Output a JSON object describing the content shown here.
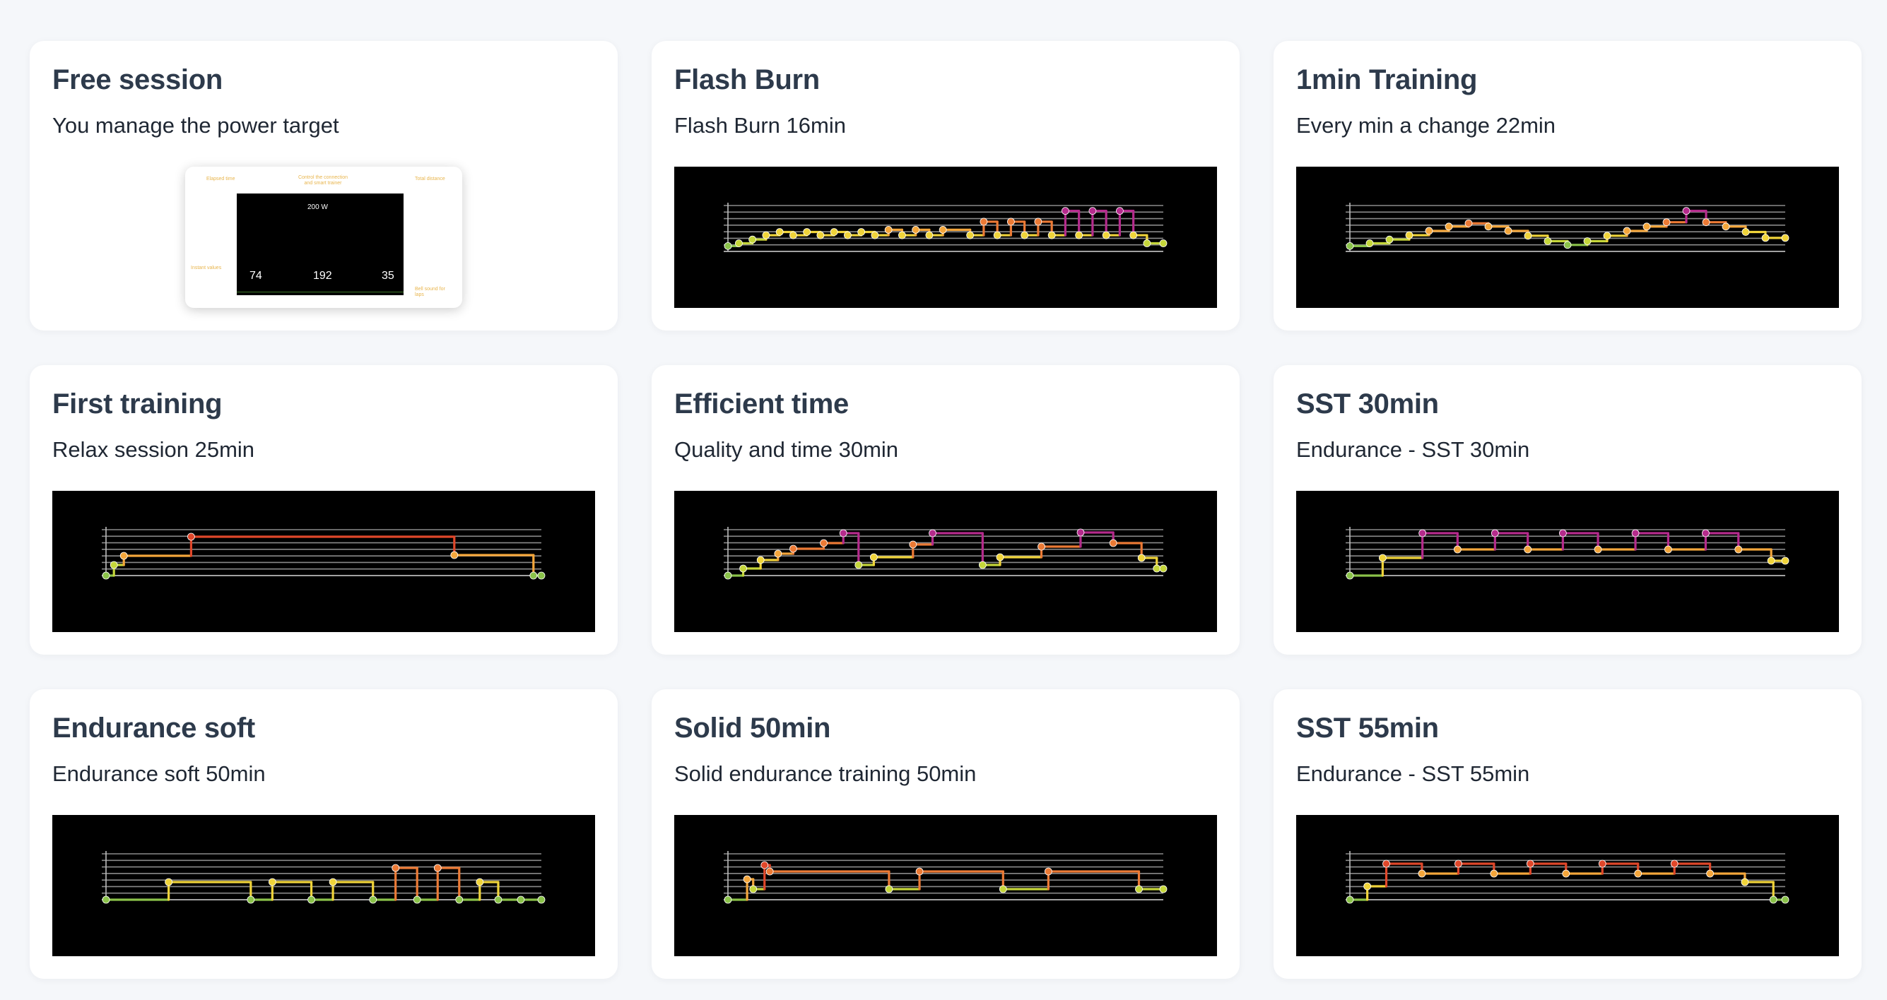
{
  "workouts": [
    {
      "title": "Free session",
      "subtitle": "You manage the power target",
      "preview": {
        "callouts": [
          "Elapsed time",
          "Control the connection and smart trainer",
          "Total distance",
          "Instant values",
          "Bell sound for laps"
        ],
        "power_label": "200 W",
        "values": [
          "74",
          "192",
          "35"
        ]
      }
    },
    {
      "title": "Flash Burn",
      "subtitle": "Flash Burn 16min",
      "chart_data": {
        "type": "line",
        "xlabel": "",
        "ylabel": "",
        "x": [
          0,
          0.4,
          0.4,
          0.9,
          0.9,
          1.4,
          1.4,
          1.9,
          1.9,
          2.4,
          2.4,
          2.9,
          2.9,
          3.4,
          3.4,
          3.9,
          3.9,
          4.4,
          4.4,
          4.9,
          4.9,
          5.4,
          5.4,
          5.9,
          5.9,
          6.4,
          6.4,
          6.9,
          6.9,
          7.4,
          7.4,
          7.9,
          7.9,
          8.9,
          8.9,
          9.4,
          9.4,
          9.9,
          9.9,
          10.4,
          10.4,
          10.9,
          10.9,
          11.4,
          11.4,
          11.9,
          11.9,
          12.4,
          12.4,
          12.9,
          12.9,
          13.4,
          13.4,
          13.9,
          13.9,
          14.4,
          14.4,
          14.9,
          14.9,
          15.4,
          15.4,
          16
        ],
        "y": [
          1.0,
          1.0,
          1.5,
          1.5,
          2.2,
          2.2,
          3.0,
          3.0,
          3.6,
          3.6,
          3.0,
          3.0,
          3.6,
          3.6,
          3.0,
          3.0,
          3.6,
          3.6,
          3.0,
          3.0,
          3.6,
          3.6,
          3.0,
          3.0,
          4.0,
          4.0,
          3.0,
          3.0,
          4.0,
          4.0,
          3.0,
          3.0,
          4.0,
          4.0,
          3.0,
          3.0,
          5.5,
          5.5,
          3.0,
          3.0,
          5.5,
          5.5,
          3.0,
          3.0,
          5.5,
          5.5,
          3.0,
          3.0,
          7.5,
          7.5,
          3.0,
          3.0,
          7.5,
          7.5,
          3.0,
          3.0,
          7.5,
          7.5,
          3.0,
          3.0,
          1.5,
          1.5
        ],
        "ylim": [
          0,
          8.5
        ]
      }
    },
    {
      "title": "1min Training",
      "subtitle": "Every min a change 22min",
      "chart_data": {
        "type": "line",
        "xlabel": "",
        "ylabel": "",
        "x": [
          0,
          1,
          1,
          2,
          2,
          3,
          3,
          4,
          4,
          5,
          5,
          6,
          6,
          7,
          7,
          8,
          8,
          9,
          9,
          10,
          10,
          11,
          11,
          12,
          12,
          13,
          13,
          14,
          14,
          15,
          15,
          16,
          16,
          17,
          17,
          18,
          18,
          19,
          19,
          20,
          20,
          21,
          21,
          22
        ],
        "y": [
          1.0,
          1.0,
          1.5,
          1.5,
          2.2,
          2.2,
          3.0,
          3.0,
          3.8,
          3.8,
          4.6,
          4.6,
          5.2,
          5.2,
          4.6,
          4.6,
          3.8,
          3.8,
          2.9,
          2.9,
          1.9,
          1.9,
          1.2,
          1.2,
          1.9,
          1.9,
          2.9,
          2.9,
          3.8,
          3.8,
          4.6,
          4.6,
          5.4,
          5.4,
          7.5,
          7.5,
          5.4,
          5.4,
          4.6,
          4.6,
          3.6,
          3.6,
          2.5,
          2.5
        ],
        "ylim": [
          0,
          8.5
        ]
      }
    },
    {
      "title": "First training",
      "subtitle": "Relax session 25min",
      "chart_data": {
        "type": "line",
        "xlabel": "",
        "ylabel": "",
        "x": [
          0,
          0.4,
          0.4,
          0.9,
          0.9,
          4.3,
          4.3,
          17.6,
          17.6,
          21.6,
          21.6,
          22
        ],
        "y": [
          0.0,
          0.0,
          1.5,
          1.5,
          2.8,
          2.8,
          5.5,
          5.5,
          2.9,
          2.9,
          0.0,
          0.0
        ],
        "ylim": [
          0,
          6.5
        ]
      }
    },
    {
      "title": "Efficient time",
      "subtitle": "Quality and time 30min",
      "chart_data": {
        "type": "line",
        "xlabel": "",
        "ylabel": "",
        "x": [
          0,
          0.7,
          0.7,
          1.5,
          1.5,
          2.3,
          2.3,
          3.0,
          3.0,
          4.4,
          4.4,
          5.3,
          5.3,
          6.0,
          6.0,
          6.7,
          6.7,
          8.5,
          8.5,
          9.4,
          9.4,
          11.7,
          11.7,
          12.5,
          12.5,
          14.4,
          14.4,
          16.2,
          16.2,
          17.7,
          17.7,
          19.0,
          19.0,
          19.7,
          19.7,
          20.0
        ],
        "y": [
          0.0,
          0.0,
          1.0,
          1.0,
          2.2,
          2.2,
          3.1,
          3.1,
          3.8,
          3.8,
          4.6,
          4.6,
          6.0,
          6.0,
          1.5,
          1.5,
          2.6,
          2.6,
          4.4,
          4.4,
          6.0,
          6.0,
          1.5,
          1.5,
          2.6,
          2.6,
          4.1,
          4.1,
          6.1,
          6.1,
          4.6,
          4.6,
          2.5,
          2.5,
          1.0,
          1.0
        ],
        "ylim": [
          0,
          6.5
        ]
      }
    },
    {
      "title": "SST 30min",
      "subtitle": "Endurance - SST 30min",
      "chart_data": {
        "type": "line",
        "xlabel": "",
        "ylabel": "",
        "x": [
          0,
          1.4,
          1.4,
          3.1,
          3.1,
          4.6,
          4.6,
          6.2,
          6.2,
          7.6,
          7.6,
          9.1,
          9.1,
          10.6,
          10.6,
          12.2,
          12.2,
          13.6,
          13.6,
          15.2,
          15.2,
          16.6,
          16.6,
          18.0,
          18.0,
          18.6
        ],
        "y": [
          0.0,
          0.0,
          2.5,
          2.5,
          6.0,
          6.0,
          3.7,
          3.7,
          6.0,
          6.0,
          3.7,
          3.7,
          6.0,
          6.0,
          3.7,
          3.7,
          6.0,
          6.0,
          3.7,
          3.7,
          6.0,
          6.0,
          3.7,
          3.7,
          2.1,
          2.1
        ],
        "ylim": [
          0,
          6.5
        ]
      }
    },
    {
      "title": "Endurance soft",
      "subtitle": "Endurance soft 50min",
      "chart_data": {
        "type": "line",
        "xlabel": "",
        "ylabel": "",
        "x": [
          0,
          6.1,
          6.1,
          14.1,
          14.1,
          16.2,
          16.2,
          20.0,
          20.0,
          22.1,
          22.1,
          26.0,
          26.0,
          28.2,
          28.2,
          30.3,
          30.3,
          32.3,
          32.3,
          34.4,
          34.4,
          36.4,
          36.4,
          38.2,
          38.2,
          40.4,
          40.4,
          42.4
        ],
        "y": [
          0.0,
          0.0,
          2.5,
          2.5,
          0.0,
          0.0,
          2.5,
          2.5,
          0.0,
          0.0,
          2.5,
          2.5,
          0.0,
          0.0,
          4.5,
          4.5,
          0.0,
          0.0,
          4.5,
          4.5,
          0.0,
          0.0,
          2.5,
          2.5,
          0.0,
          0.0,
          0.0,
          0.0
        ],
        "ylim": [
          0,
          6.5
        ]
      }
    },
    {
      "title": "Solid 50min",
      "subtitle": "Solid endurance training 50min",
      "chart_data": {
        "type": "line",
        "xlabel": "",
        "ylabel": "",
        "x": [
          0,
          2.2,
          2.2,
          2.9,
          2.9,
          4.2,
          4.2,
          4.8,
          4.8,
          18.5,
          18.5,
          22.0,
          22.0,
          31.6,
          31.6,
          36.8,
          36.8,
          47.2,
          47.2,
          50.0
        ],
        "y": [
          0.0,
          0.0,
          2.9,
          2.9,
          1.5,
          1.5,
          4.9,
          4.9,
          4.0,
          4.0,
          1.5,
          1.5,
          4.0,
          4.0,
          1.5,
          1.5,
          4.0,
          4.0,
          1.5,
          1.5
        ],
        "ylim": [
          0,
          6.5
        ]
      }
    },
    {
      "title": "SST 55min",
      "subtitle": "Endurance - SST 55min",
      "chart_data": {
        "type": "line",
        "xlabel": "",
        "ylabel": "",
        "x": [
          0,
          2.2,
          2.2,
          4.6,
          4.6,
          9.1,
          9.1,
          13.7,
          13.7,
          18.2,
          18.2,
          22.8,
          22.8,
          27.3,
          27.3,
          31.9,
          31.9,
          36.4,
          36.4,
          41.0,
          41.0,
          45.5,
          45.5,
          49.9,
          49.9,
          53.5,
          53.5,
          55.0
        ],
        "y": [
          0.0,
          0.0,
          1.9,
          1.9,
          5.1,
          5.1,
          3.7,
          3.7,
          5.1,
          5.1,
          3.7,
          3.7,
          5.1,
          5.1,
          3.7,
          3.7,
          5.1,
          5.1,
          3.7,
          3.7,
          5.1,
          5.1,
          3.7,
          3.7,
          2.5,
          2.5,
          0.0,
          0.0
        ],
        "ylim": [
          0,
          6.5
        ]
      }
    }
  ],
  "zone_colors": [
    "#8bc34a",
    "#c5d63a",
    "#f0d43a",
    "#f4a63b",
    "#ec7a35",
    "#e0472a",
    "#b52b8c"
  ]
}
